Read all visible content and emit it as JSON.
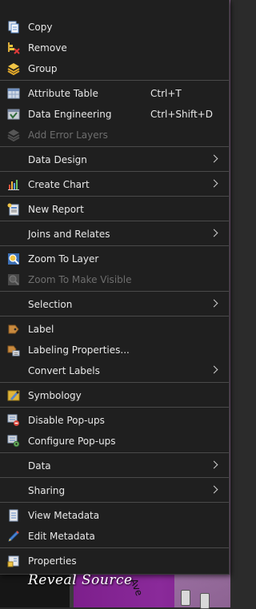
{
  "menu": {
    "items": [
      {
        "label": "Copy",
        "icon": "copy-icon"
      },
      {
        "label": "Remove",
        "icon": "remove-icon"
      },
      {
        "label": "Group",
        "icon": "group-icon"
      },
      {
        "label": "Attribute Table",
        "shortcut": "Ctrl+T",
        "icon": "table-icon"
      },
      {
        "label": "Data Engineering",
        "shortcut": "Ctrl+Shift+D",
        "icon": "data-engineering-icon"
      },
      {
        "label": "Add Error Layers",
        "icon": "error-layers-icon",
        "disabled": true
      },
      {
        "label": "Data Design",
        "submenu": true
      },
      {
        "label": "Create Chart",
        "icon": "chart-icon",
        "submenu": true
      },
      {
        "label": "New Report",
        "icon": "report-icon"
      },
      {
        "label": "Joins and Relates",
        "submenu": true
      },
      {
        "label": "Zoom To Layer",
        "icon": "zoom-to-layer-icon"
      },
      {
        "label": "Zoom To Make Visible",
        "icon": "zoom-visible-icon",
        "disabled": true
      },
      {
        "label": "Selection",
        "submenu": true
      },
      {
        "label": "Label",
        "icon": "label-icon"
      },
      {
        "label": "Labeling Properties...",
        "icon": "labeling-properties-icon"
      },
      {
        "label": "Convert Labels",
        "submenu": true
      },
      {
        "label": "Symbology",
        "icon": "symbology-icon"
      },
      {
        "label": "Disable Pop-ups",
        "icon": "disable-popups-icon"
      },
      {
        "label": "Configure Pop-ups",
        "icon": "configure-popups-icon"
      },
      {
        "label": "Data",
        "submenu": true
      },
      {
        "label": "Sharing",
        "submenu": true
      },
      {
        "label": "View Metadata",
        "icon": "view-metadata-icon"
      },
      {
        "label": "Edit Metadata",
        "icon": "edit-metadata-icon"
      },
      {
        "label": "Properties",
        "icon": "properties-icon"
      }
    ]
  },
  "overlay": {
    "watermark": "Reveal Source",
    "street_label": "Ave"
  },
  "colors": {
    "menu_bg": "#1f1f1f",
    "map_purple": "#8a2a9a",
    "separator": "#4a4a4a"
  }
}
